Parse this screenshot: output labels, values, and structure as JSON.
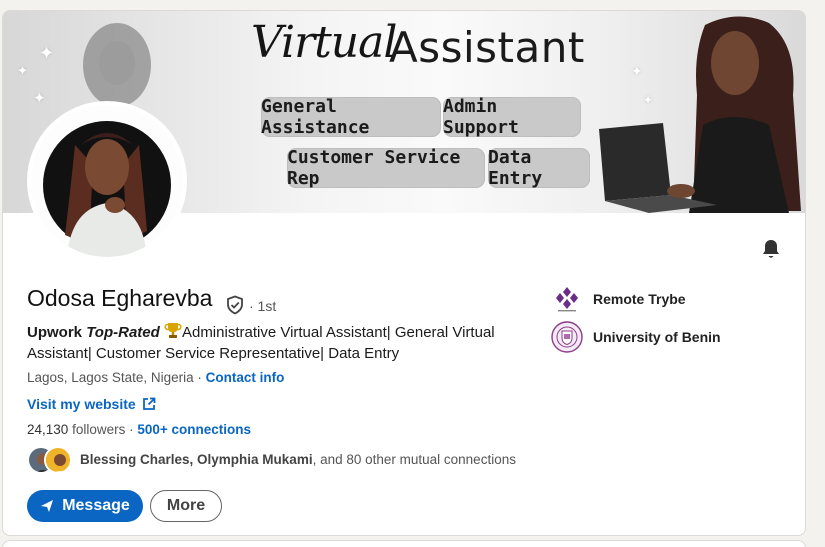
{
  "banner": {
    "script_word": "Virtual",
    "title_word": "Assistant",
    "pills": [
      "General Assistance",
      "Admin Support",
      "Customer Service Rep",
      "Data Entry"
    ]
  },
  "profile": {
    "name": "Odosa Egharevba",
    "degree": "· 1st",
    "headline_bold": "Upwork",
    "headline_bold_italic": "Top-Rated",
    "headline_rest": "Administrative Virtual Assistant| General Virtual Assistant| Customer Service Representative| Data Entry",
    "location": "Lagos, Lagos State, Nigeria",
    "location_sep": " · ",
    "contact_info": "Contact info",
    "website_label": "Visit my website",
    "followers_count": "24,130",
    "followers_label": "followers",
    "followers_sep": " · ",
    "connections": "500+ connections",
    "mutual_names": "Blessing Charles, Olymphia Mukami",
    "mutual_rest": ", and 80 other mutual connections"
  },
  "actions": {
    "message": "Message",
    "more": "More"
  },
  "experience": [
    {
      "name": "Remote Trybe",
      "logo_icon": "remote-trybe-logo"
    },
    {
      "name": "University of Benin",
      "logo_icon": "university-of-benin-logo"
    }
  ],
  "colors": {
    "link_blue": "#0a66c2",
    "page_bg": "#f4f2ee"
  }
}
